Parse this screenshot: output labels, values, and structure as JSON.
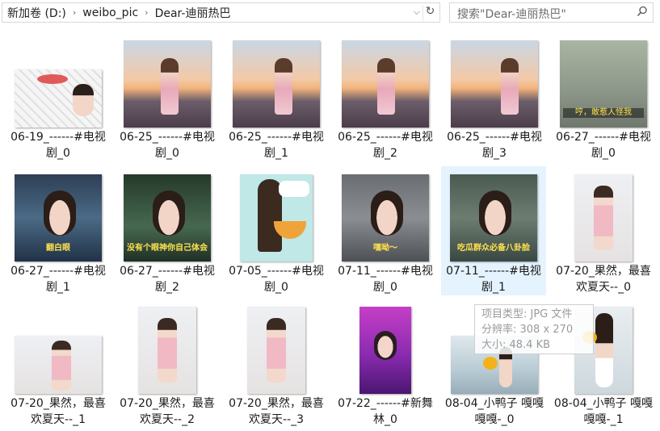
{
  "breadcrumb": {
    "drive": "新加卷 (D:)",
    "folder1": "weibo_pic",
    "folder2": "Dear-迪丽热巴"
  },
  "search": {
    "placeholder": "搜索\"Dear-迪丽热巴\""
  },
  "files": [
    {
      "name": "06-19_------#电视剧_0"
    },
    {
      "name": "06-25_------#电视剧_0"
    },
    {
      "name": "06-25_------#电视剧_1"
    },
    {
      "name": "06-25_------#电视剧_2"
    },
    {
      "name": "06-25_------#电视剧_3"
    },
    {
      "name": "06-27_------#电视剧_0"
    },
    {
      "name": "06-27_------#电视剧_1"
    },
    {
      "name": "06-27_------#电视剧_2"
    },
    {
      "name": "07-05_------#电视剧_0"
    },
    {
      "name": "07-11_------#电视剧_0"
    },
    {
      "name": "07-11_------#电视剧_1"
    },
    {
      "name": "07-20_果然，最喜欢夏天--_0"
    },
    {
      "name": "07-20_果然，最喜欢夏天--_1"
    },
    {
      "name": "07-20_果然，最喜欢夏天--_2"
    },
    {
      "name": "07-20_果然，最喜欢夏天--_3"
    },
    {
      "name": "07-22_------#新舞林_0"
    },
    {
      "name": "08-04_小鸭子 嘎嘎嘎嘎-_0"
    },
    {
      "name": "08-04_小鸭子 嘎嘎嘎嘎-_1"
    }
  ],
  "subtitles": {
    "t5": "哼，敢惹人怪我",
    "t6": "翻白眼",
    "t7": "没有个眼神你自己体会",
    "t9": "嘿呦～",
    "t10": "吃瓜群众必备八卦脸"
  },
  "tooltip": {
    "type": "项目类型: JPG 文件",
    "dimensions": "分辨率: 308 x 270",
    "size": "大小: 48.4 KB"
  }
}
